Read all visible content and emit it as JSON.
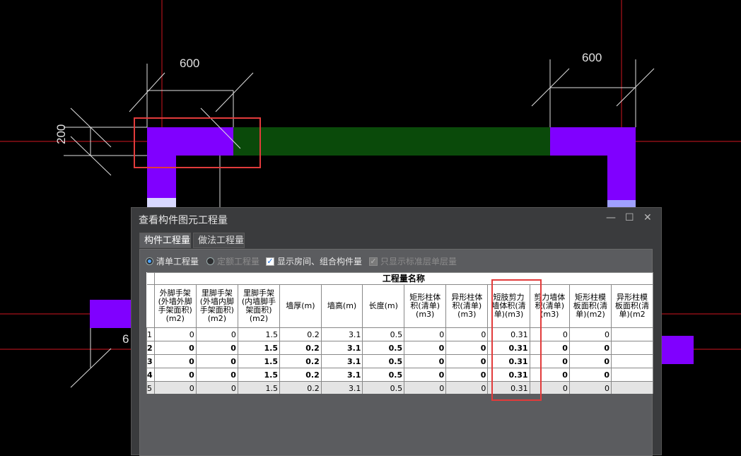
{
  "cad": {
    "dim_top_left": "600",
    "dim_top_right": "600",
    "dim_left_vertical": "200",
    "dim_partial": "6",
    "colors": {
      "purple_wall": "#8000ff",
      "green_wall": "#0a4a0a",
      "axis_line": "#d0161f",
      "highlight": "#e23b3b"
    }
  },
  "dialog": {
    "title": "查看构件图元工程量",
    "controls": [
      "—",
      "☐",
      "✕"
    ],
    "tabs": [
      {
        "label": "构件工程量",
        "active": true
      },
      {
        "label": "做法工程量",
        "active": false
      }
    ],
    "options": [
      {
        "type": "radio",
        "label": "清单工程量",
        "checked": true,
        "disabled": false
      },
      {
        "type": "radio",
        "label": "定额工程量",
        "checked": false,
        "disabled": true
      },
      {
        "type": "checkbox",
        "label": "显示房间、组合构件量",
        "checked": true,
        "disabled": false
      },
      {
        "type": "checkbox",
        "label": "只显示标准层单层量",
        "checked": true,
        "disabled": true
      }
    ],
    "table": {
      "group_header": "工程量名称",
      "columns": [
        "外脚手架(外墙外脚手架面积)(m2)",
        "里脚手架(外墙内脚手架面积)(m2)",
        "里脚手架(内墙脚手架面积)(m2)",
        "墙厚(m)",
        "墙高(m)",
        "长度(m)",
        "矩形柱体积(清单)(m3)",
        "异形柱体积(清单)(m3)",
        "短肢剪力墙体积(清单)(m3)",
        "剪力墙体积(清单)(m3)",
        "矩形柱模板面积(清单)(m2)",
        "异形柱模板面积(清单)(m2"
      ],
      "rows": [
        {
          "n": "1",
          "bold": false,
          "cells": [
            "0",
            "0",
            "1.5",
            "0.2",
            "3.1",
            "0.5",
            "0",
            "0",
            "0.31",
            "0",
            "0",
            ""
          ]
        },
        {
          "n": "2",
          "bold": true,
          "cells": [
            "0",
            "0",
            "1.5",
            "0.2",
            "3.1",
            "0.5",
            "0",
            "0",
            "0.31",
            "0",
            "0",
            ""
          ]
        },
        {
          "n": "3",
          "bold": true,
          "cells": [
            "0",
            "0",
            "1.5",
            "0.2",
            "3.1",
            "0.5",
            "0",
            "0",
            "0.31",
            "0",
            "0",
            ""
          ]
        },
        {
          "n": "4",
          "bold": true,
          "cells": [
            "0",
            "0",
            "1.5",
            "0.2",
            "3.1",
            "0.5",
            "0",
            "0",
            "0.31",
            "0",
            "0",
            ""
          ]
        },
        {
          "n": "5",
          "bold": false,
          "cells": [
            "0",
            "0",
            "1.5",
            "0.2",
            "3.1",
            "0.5",
            "0",
            "0",
            "0.31",
            "0",
            "0",
            ""
          ]
        }
      ]
    }
  }
}
